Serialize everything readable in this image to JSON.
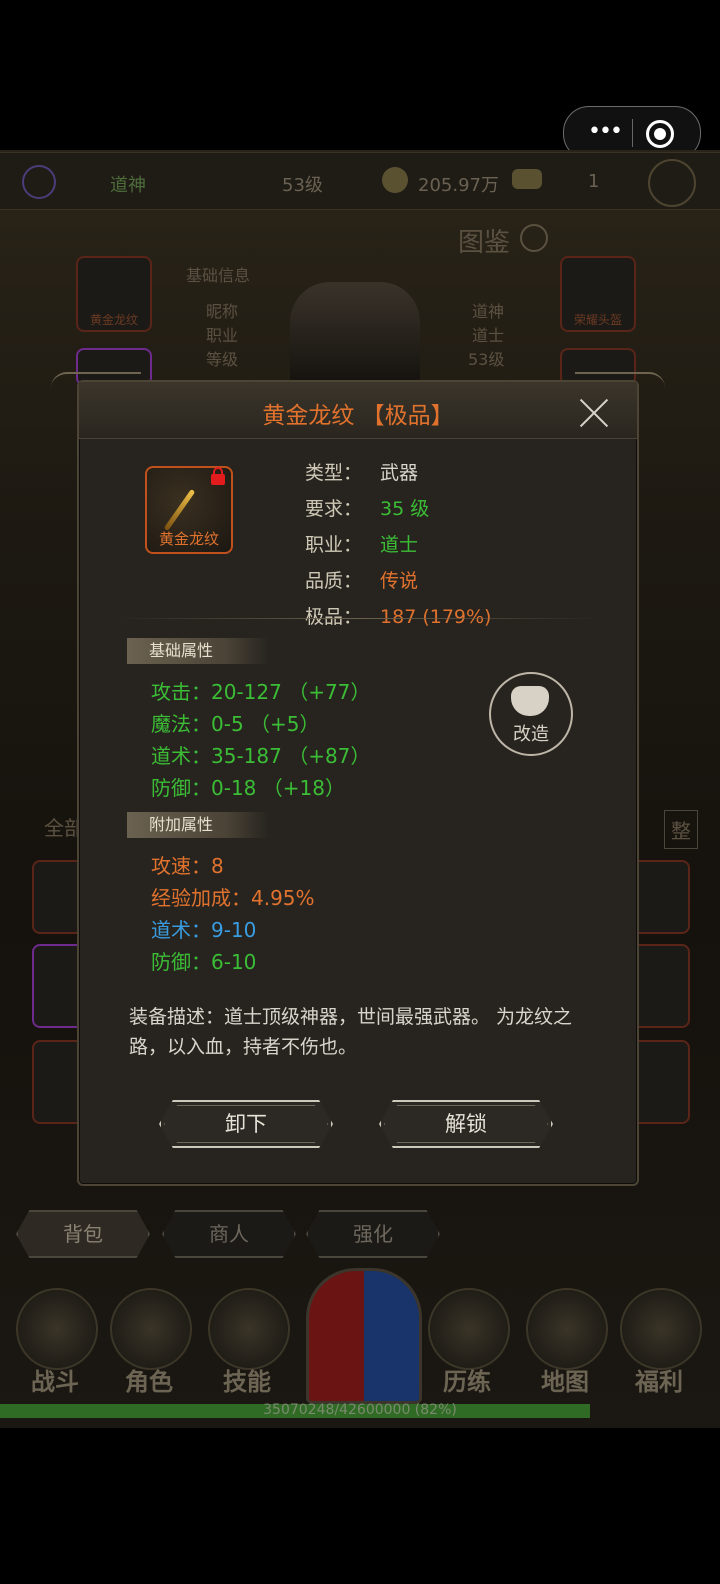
{
  "capsule": {
    "more_icon": "more-dots-icon",
    "close_icon": "record-icon"
  },
  "topbar": {
    "name": "道神",
    "level": "53级",
    "gold": "205.97万",
    "ingot": "1"
  },
  "background": {
    "codex_title": "图鉴",
    "basic_info_title": "基础信息",
    "labels": [
      "昵称",
      "职业",
      "等级"
    ],
    "values": [
      "道神",
      "道士",
      "53级"
    ],
    "left_slot_label": "黄金龙纹",
    "right_slot_label": "荣耀头盔",
    "filter_left": "全部",
    "filter_right": "整"
  },
  "modal": {
    "title": "黄金龙纹 【极品】",
    "item_label": "黄金龙纹",
    "info": [
      {
        "k": "类型：",
        "v": "武器",
        "color": "#d9d5cc"
      },
      {
        "k": "要求：",
        "v": "35 级",
        "color": "#3bbd36"
      },
      {
        "k": "职业：",
        "v": "道士",
        "color": "#3bbd36"
      },
      {
        "k": "品质：",
        "v": "传说",
        "color": "#e0722e"
      },
      {
        "k": "极品：",
        "v": "187 (179%)",
        "color": "#e0722e"
      }
    ],
    "base_title": "基础属性",
    "base_attrs": [
      {
        "k": "攻击：",
        "v": "20-127 （+77）"
      },
      {
        "k": "魔法：",
        "v": "0-5 （+5）"
      },
      {
        "k": "道术：",
        "v": "35-187 （+87）"
      },
      {
        "k": "防御：",
        "v": "0-18 （+18）"
      }
    ],
    "extra_title": "附加属性",
    "extra_attrs": [
      {
        "k": "攻速：",
        "v": "8",
        "color": "#e0722e"
      },
      {
        "k": "经验加成：",
        "v": "4.95%",
        "color": "#e0722e"
      },
      {
        "k": "道术：",
        "v": "9-10",
        "color": "#3a9ce0"
      },
      {
        "k": "防御：",
        "v": "6-10",
        "color": "#3bbd36"
      }
    ],
    "reforge_label": "改造",
    "description": "装备描述：道士顶级神器，世间最强武器。 为龙纹之路，以入血，持者不伤也。",
    "unequip_label": "卸下",
    "unlock_label": "解锁"
  },
  "bottom_tabs": [
    "背包",
    "商人",
    "强化"
  ],
  "nav": [
    "战斗",
    "角色",
    "技能",
    "历练",
    "地图",
    "福利"
  ],
  "exp_text": "35070248/42600000 (82%)",
  "exp_progress": 0.82
}
